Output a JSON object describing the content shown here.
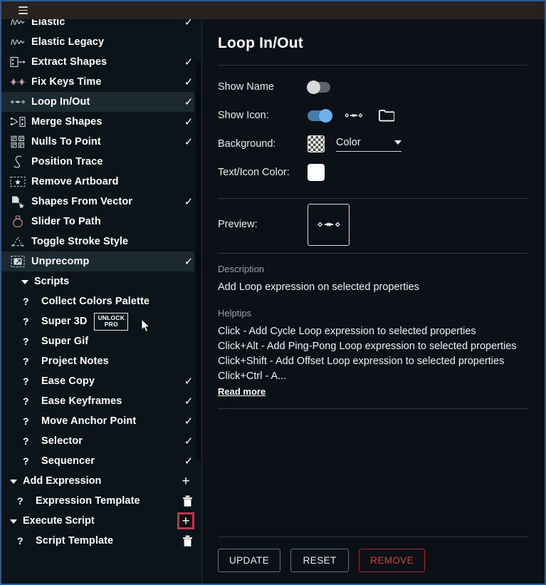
{
  "window": {
    "accent_border": "#2c5a96",
    "topbar_bg": "#262220",
    "menu_icon": "hamburger-icon"
  },
  "sidebar": {
    "items": [
      {
        "label": "Elastic",
        "icon": "elastic-wave-icon",
        "checked": true,
        "selected": false,
        "level": 1,
        "type": "tool"
      },
      {
        "label": "Elastic Legacy",
        "icon": "elastic-wave-icon",
        "checked": false,
        "selected": false,
        "level": 1,
        "type": "tool"
      },
      {
        "label": "Extract Shapes",
        "icon": "extract-shapes-icon",
        "checked": true,
        "selected": false,
        "level": 1,
        "type": "tool"
      },
      {
        "label": "Fix Keys Time",
        "icon": "fix-keys-time-icon",
        "checked": true,
        "selected": false,
        "level": 1,
        "type": "tool"
      },
      {
        "label": "Loop In/Out",
        "icon": "loop-in-out-icon",
        "checked": true,
        "selected": true,
        "level": 1,
        "type": "tool"
      },
      {
        "label": "Merge Shapes",
        "icon": "merge-shapes-icon",
        "checked": true,
        "selected": false,
        "level": 1,
        "type": "tool"
      },
      {
        "label": "Nulls To Point",
        "icon": "nulls-to-point-icon",
        "checked": true,
        "selected": false,
        "level": 1,
        "type": "tool"
      },
      {
        "label": "Position Trace",
        "icon": "position-trace-icon",
        "checked": false,
        "selected": false,
        "level": 1,
        "type": "tool"
      },
      {
        "label": "Remove Artboard",
        "icon": "remove-artboard-icon",
        "checked": false,
        "selected": false,
        "level": 1,
        "type": "tool"
      },
      {
        "label": "Shapes From Vector",
        "icon": "shapes-from-vector-icon",
        "checked": true,
        "selected": false,
        "level": 1,
        "type": "tool"
      },
      {
        "label": "Slider To Path",
        "icon": "slider-to-path-icon",
        "checked": false,
        "selected": false,
        "level": 1,
        "type": "tool"
      },
      {
        "label": "Toggle Stroke Style",
        "icon": "toggle-stroke-style-icon",
        "checked": false,
        "selected": false,
        "level": 1,
        "type": "tool"
      },
      {
        "label": "Unprecomp",
        "icon": "unprecomp-icon",
        "checked": true,
        "selected": true,
        "level": 1,
        "type": "tool"
      }
    ],
    "groups": {
      "scripts": {
        "label": "Scripts",
        "expanded": true,
        "items": [
          {
            "label": "Collect Colors Palette",
            "checked": false,
            "badge": null
          },
          {
            "label": "Super 3D",
            "checked": false,
            "badge": [
              "UNLOCK",
              "PRO"
            ]
          },
          {
            "label": "Super Gif",
            "checked": false,
            "badge": null
          },
          {
            "label": "Project Notes",
            "checked": false,
            "badge": null
          },
          {
            "label": "Ease Copy",
            "checked": true,
            "badge": null
          },
          {
            "label": "Ease Keyframes",
            "checked": true,
            "badge": null
          },
          {
            "label": "Move Anchor Point",
            "checked": true,
            "badge": null
          },
          {
            "label": "Selector",
            "checked": true,
            "badge": null
          },
          {
            "label": "Sequencer",
            "checked": true,
            "badge": null
          }
        ]
      },
      "add_expression": {
        "label": "Add Expression",
        "expanded": true,
        "add_label": "+",
        "add_highlighted": false,
        "items": [
          {
            "label": "Expression Template",
            "action": "delete"
          }
        ]
      },
      "execute_script": {
        "label": "Execute Script",
        "expanded": true,
        "add_label": "+",
        "add_highlighted": true,
        "highlight_color": "#b6354f",
        "items": [
          {
            "label": "Script Template",
            "action": "delete"
          }
        ]
      }
    }
  },
  "detail": {
    "title": "Loop In/Out",
    "fields": {
      "show_name": {
        "label": "Show Name",
        "value": false
      },
      "show_icon": {
        "label": "Show Icon:",
        "value": true,
        "icon_preview": "loop-in-out-icon",
        "browse": "folder-icon"
      },
      "background": {
        "label": "Background:",
        "swatch": "checker-transparent",
        "mode": "Color"
      },
      "text_icon_color": {
        "label": "Text/Icon Color:",
        "color": "#ffffff"
      }
    },
    "preview": {
      "label": "Preview:",
      "icon": "loop-in-out-icon"
    },
    "description": {
      "title": "Description",
      "text": "Add Loop expression on selected properties"
    },
    "helptips": {
      "title": "Helptips",
      "lines": [
        "Click - Add Cycle Loop expression to selected properties",
        "Click+Alt - Add Ping-Pong Loop expression to selected properties",
        "Click+Shift - Add Offset Loop expression to selected properties",
        "Click+Ctrl - A..."
      ],
      "read_more": "Read more"
    },
    "buttons": {
      "update": "UPDATE",
      "reset": "RESET",
      "remove": "REMOVE",
      "remove_color": "#e33b3b"
    }
  }
}
